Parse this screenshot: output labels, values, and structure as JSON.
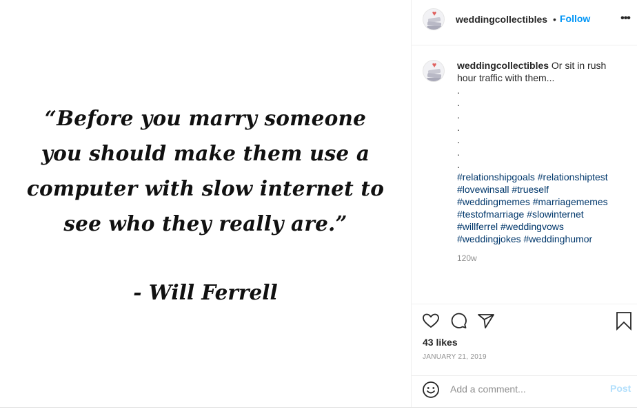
{
  "post_image": {
    "quote_lines": [
      "“Before you marry someone",
      "you should make them use a",
      "computer with slow internet to",
      "see who they really are.”"
    ],
    "attribution": "- Will Ferrell"
  },
  "header": {
    "username": "weddingcollectibles",
    "separator": "•",
    "follow_label": "Follow",
    "more_icon": "•••"
  },
  "caption": {
    "username": "weddingcollectibles",
    "text": " Or sit in rush hour traffic with them...",
    "dots": [
      ".",
      ".",
      ".",
      ".",
      ".",
      ".",
      "."
    ],
    "hashtags": [
      "#relationshipgoals",
      "#relationshiptest",
      "#lovewinsall",
      "#trueself",
      "#weddingmemes",
      "#marriagememes",
      "#testofmarriage",
      "#slowinternet",
      "#willferrel",
      "#weddingvows",
      "#weddingjokes",
      "#weddinghumor"
    ],
    "time_ago": "120w"
  },
  "actions": {
    "icons": [
      "heart-icon",
      "comment-icon",
      "share-icon",
      "bookmark-icon"
    ],
    "likes": "43 likes",
    "date": "JANUARY 21, 2019"
  },
  "comment": {
    "placeholder": "Add a comment...",
    "post_label": "Post"
  },
  "colors": {
    "accent": "#0095f6",
    "hashtag": "#00376b",
    "muted": "#8e8e8e",
    "post_disabled": "#b2dffc"
  }
}
